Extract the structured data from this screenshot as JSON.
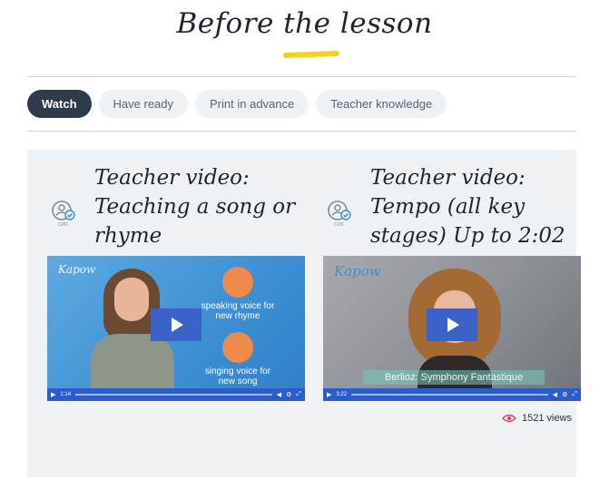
{
  "header": {
    "title": "Before the lesson"
  },
  "tabs": [
    {
      "label": "Watch",
      "active": true
    },
    {
      "label": "Have ready",
      "active": false
    },
    {
      "label": "Print in advance",
      "active": false
    },
    {
      "label": "Teacher knowledge",
      "active": false
    }
  ],
  "videos": [
    {
      "title": "Teacher video: Teaching a song or rhyme",
      "icon": "cpd-icon",
      "brand": "Kapow",
      "captions": [
        "speaking voice for new rhyme",
        "singing voice for new song"
      ],
      "time": "1:14"
    },
    {
      "title": "Teacher video: Tempo (all key stages) Up to 2:02",
      "icon": "cpd-icon",
      "brand": "Kapow",
      "lower_third": "Berlioz: Symphony Fantastique",
      "time": "3:22",
      "views": "1521 views"
    }
  ],
  "colors": {
    "accent_yellow": "#f5d21a",
    "active_tab": "#2e3b4a",
    "panel": "#eef2f5",
    "play": "#3a62c9",
    "views_eye": "#d9455f"
  }
}
